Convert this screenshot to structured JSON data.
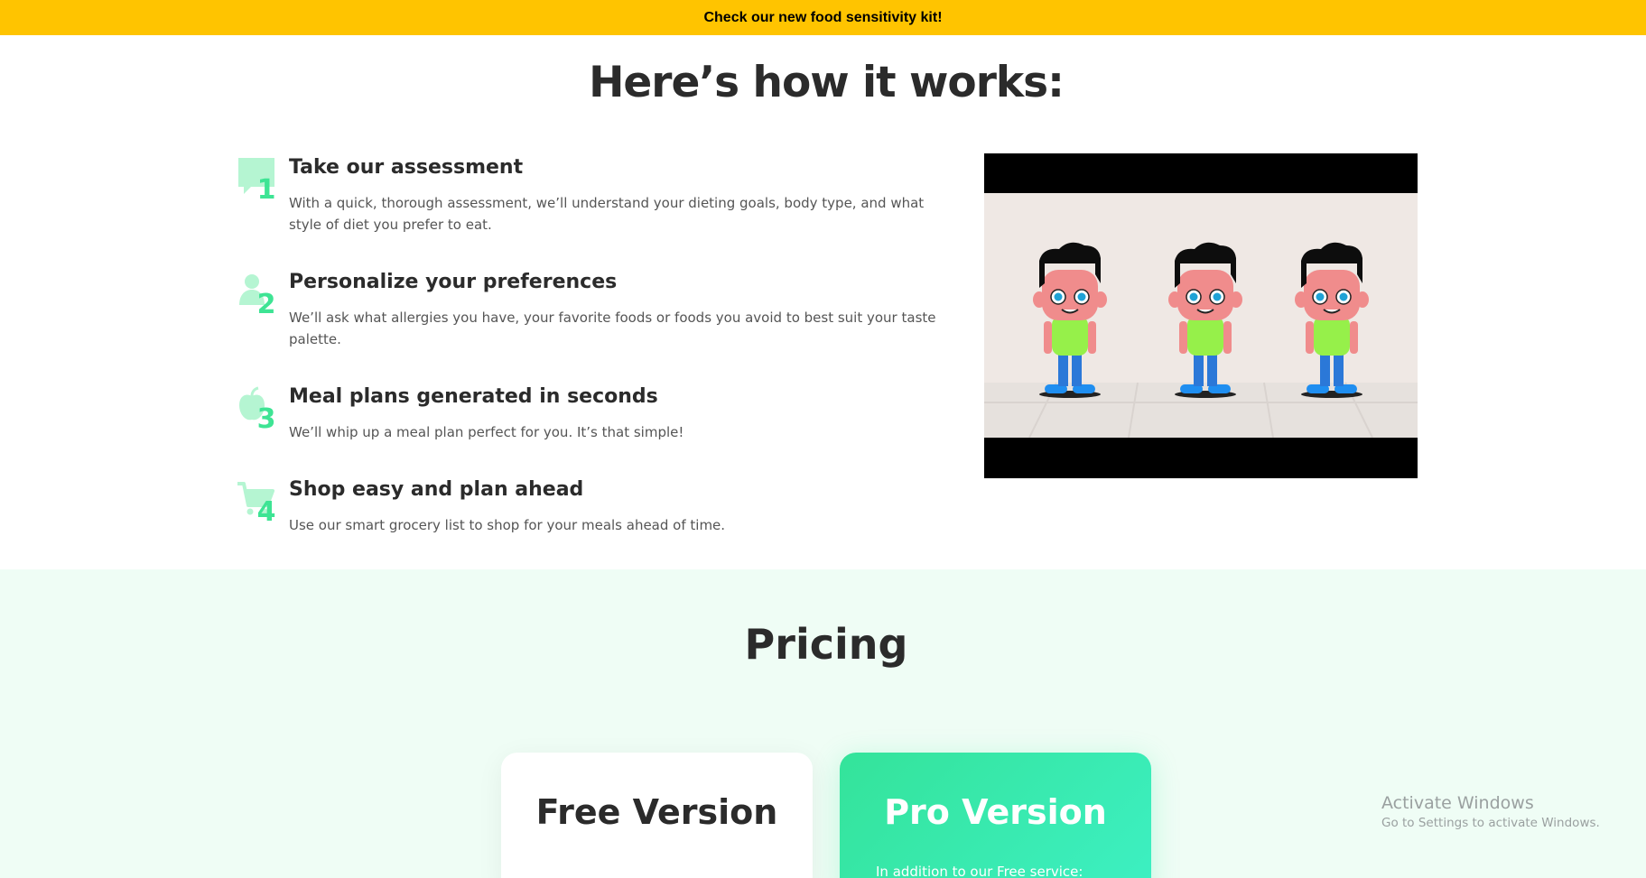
{
  "banner": {
    "text": "Check our new food sensitivity kit!"
  },
  "how_it_works": {
    "title": "Here’s how it works:",
    "steps": [
      {
        "number": "1",
        "icon": "chat-bubble-icon",
        "heading": "Take our assessment",
        "text": "With a quick, thorough assessment, we’ll understand your dieting goals, body type, and what style of diet you prefer to eat."
      },
      {
        "number": "2",
        "icon": "person-icon",
        "heading": "Personalize your preferences",
        "text": "We’ll ask what allergies you have, your favorite foods or foods you avoid to best suit your taste palette."
      },
      {
        "number": "3",
        "icon": "apple-icon",
        "heading": "Meal plans generated in seconds",
        "text": "We’ll whip up a meal plan perfect for you. It’s that simple!"
      },
      {
        "number": "4",
        "icon": "cart-icon",
        "heading": "Shop easy and plan ahead",
        "text": "Use our smart grocery list to shop for your meals ahead of time."
      }
    ]
  },
  "pricing": {
    "title": "Pricing",
    "free": {
      "title": "Free Version"
    },
    "pro": {
      "title": "Pro Version",
      "note": "In addition to our Free service:"
    }
  },
  "watermark": {
    "title": "Activate Windows",
    "subtitle": "Go to Settings to activate Windows."
  },
  "colors": {
    "banner": "#ffc400",
    "accent": "#3ee494",
    "icon_light": "#b5f5d2",
    "pricing_bg": "#effdf5"
  }
}
